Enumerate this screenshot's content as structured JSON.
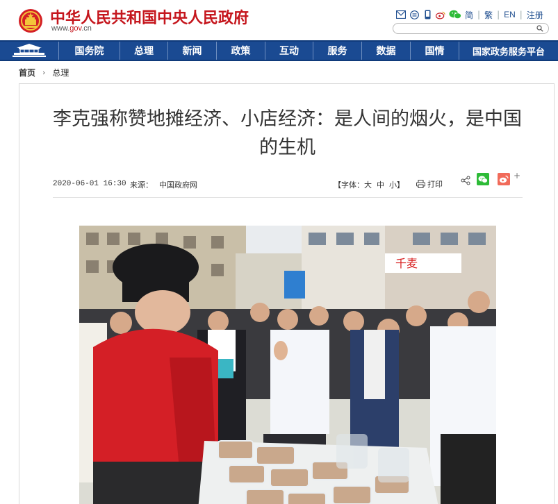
{
  "header": {
    "site_title": "中华人民共和国中央人民政府",
    "domain_prefix": "www.",
    "domain_main": "gov",
    "domain_suffix": ".cn",
    "tools": {
      "lang_simplified": "简",
      "lang_traditional": "繁",
      "lang_english": "EN",
      "register": "注册",
      "icons": [
        "mail-icon",
        "rss-icon",
        "mobile-icon",
        "weibo-icon",
        "wechat-icon"
      ]
    },
    "search_placeholder": ""
  },
  "nav": {
    "items": [
      "国务院",
      "总理",
      "新闻",
      "政策",
      "互动",
      "服务",
      "数据",
      "国情",
      "国家政务服务平台"
    ]
  },
  "breadcrumb": {
    "home": "首页",
    "separator": "›",
    "current": "总理"
  },
  "article": {
    "title": "李克强称赞地摊经济、小店经济：是人间的烟火，是中国的生机",
    "date": "2020-06-01 16:30",
    "source_label": "来源：",
    "source": "中国政府网",
    "font_label": "【字体：",
    "font_large": "大",
    "font_medium": "中",
    "font_small": "小",
    "font_close": "】",
    "print": "打印",
    "plus": "+"
  },
  "colors": {
    "brand_red": "#c5161d",
    "nav_blue": "#1a4a92",
    "link_blue": "#1f4e8f",
    "wechat_green": "#2dbb37",
    "weibo_red": "#f16b5a"
  }
}
